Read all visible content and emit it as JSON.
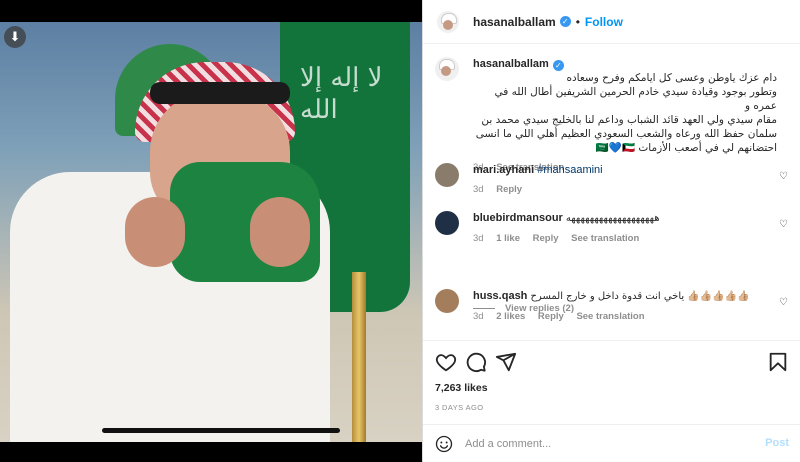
{
  "post": {
    "username": "hasanalballam",
    "follow_label": "Follow",
    "separator": "•",
    "caption_line1": "دام عزك ياوطن وعسى كل ايامكم وفرح وسعاده",
    "caption_line2": "وتطور بوجود وقيادة سيدي خادم الحرمين الشريفين أطال الله في عمره و",
    "caption_line3": "مقام سيدي ولي العهد قائد الشباب وداعم لنا بالخليج سيدي محمد بن",
    "caption_line4": "سلمان حفظ الله ورعاه والشعب السعودي العظيم أهلي اللي ما انسى",
    "caption_line5": "احتضانهم لي في أصعب الأزمات 🇸🇦💙🇰🇼",
    "caption_time": "3d",
    "see_translation": "See translation"
  },
  "comments": [
    {
      "username": "mari.ayhani",
      "text": "#mahsaamini",
      "time": "3d",
      "reply": "Reply"
    },
    {
      "username": "bluebirdmansour",
      "text": "هههههههههههههههههههه",
      "time": "3d",
      "likes": "1 like",
      "reply": "Reply",
      "translate": "See translation",
      "view_replies": "View replies (2)"
    },
    {
      "username": "huss.qash",
      "text": "ياخي انت قدوة داخل و خارج المسرح 👍🏼👍🏼👍🏼👍🏼👍🏼",
      "time": "3d",
      "likes": "2 likes",
      "reply": "Reply",
      "translate": "See translation"
    }
  ],
  "actions": {
    "likes": "7,263 likes",
    "date": "3 DAYS AGO",
    "add_comment_placeholder": "Add a comment...",
    "post_label": "Post"
  },
  "media": {
    "flag_text": "لا إله إلا الله",
    "download_icon": "arrow-down-icon"
  },
  "colors": {
    "accent": "#0095f6",
    "verified": "#3897f0",
    "hashtag": "#00376b",
    "muted": "#8e8e8e"
  }
}
